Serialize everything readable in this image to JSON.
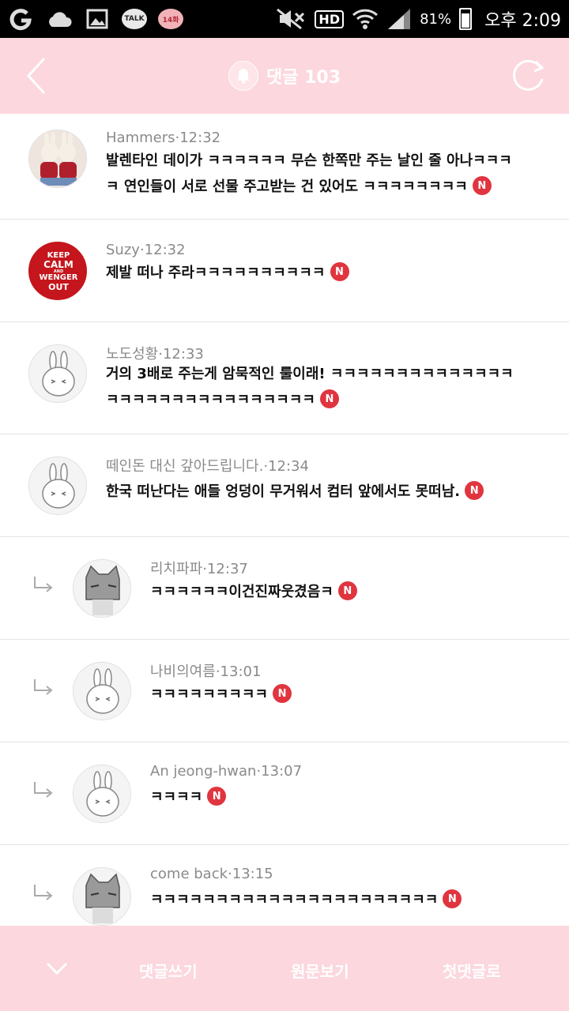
{
  "status_bar": {
    "talk_label": "TALK",
    "badge_label": "14화",
    "hd_label": "HD",
    "battery": "81%",
    "time": "오후 2:09"
  },
  "header": {
    "title": "댓글 103"
  },
  "comments": [
    {
      "author": "Hammers",
      "time": "12:32",
      "text": "발렌타인 데이가 ㅋㅋㅋㅋㅋㅋ 무슨 한쪽만 주는 날인 줄 아나ㅋㅋㅋㅋ 연인들이 서로 선물 주고받는 건 있어도 ㅋㅋㅋㅋㅋㅋㅋㅋ",
      "avatar": "bunny-dolls-photo",
      "badge": "N"
    },
    {
      "author": "Suzy",
      "time": "12:32",
      "text": "제발 떠나 주라ㅋㅋㅋㅋㅋㅋㅋㅋㅋㅋ",
      "avatar": "keep-calm-poster",
      "avatar_lines": [
        "KEEP",
        "CALM",
        "AND",
        "WENGER",
        "OUT"
      ],
      "badge": "N"
    },
    {
      "author": "노도성황",
      "time": "12:33",
      "text": "거의 3배로 주는게 암묵적인 룰이래! ㅋㅋㅋㅋㅋㅋㅋㅋㅋㅋㅋㅋㅋㅋㅋㅋㅋㅋㅋㅋㅋㅋㅋㅋㅋㅋㅋㅋㅋㅋ",
      "avatar": "default-bunny",
      "badge": "N"
    },
    {
      "author": "떼인돈 대신 갚아드립니다.",
      "time": "12:34",
      "text": "한국 떠난다는 애들 엉덩이 무거워서 컴터 앞에서도 못떠남.",
      "avatar": "default-bunny",
      "badge": "N"
    },
    {
      "author": "리치파파",
      "time": "12:37",
      "text": "ㅋㅋㅋㅋㅋㅋ이건진짜웃겼음ㅋ",
      "avatar": "cat-character",
      "badge": "N",
      "reply": true
    },
    {
      "author": "나비의여름",
      "time": "13:01",
      "text": "ㅋㅋㅋㅋㅋㅋㅋㅋㅋ",
      "avatar": "default-bunny",
      "badge": "N",
      "reply": true
    },
    {
      "author": "An jeong-hwan",
      "time": "13:07",
      "text": "ㅋㅋㅋㅋ",
      "avatar": "default-bunny",
      "badge": "N",
      "reply": true
    },
    {
      "author": "come back",
      "time": "13:15",
      "text": "ㅋㅋㅋㅋㅋㅋㅋㅋㅋㅋㅋㅋㅋㅋㅋㅋㅋㅋㅋㅋㅋㅋ",
      "avatar": "cat-character",
      "badge": "N",
      "reply": true
    }
  ],
  "bottom_bar": {
    "write": "댓글쓰기",
    "original": "원문보기",
    "first": "첫댓글로"
  },
  "colors": {
    "header_pink": "#fcd7de",
    "badge_red": "#e0353f"
  }
}
